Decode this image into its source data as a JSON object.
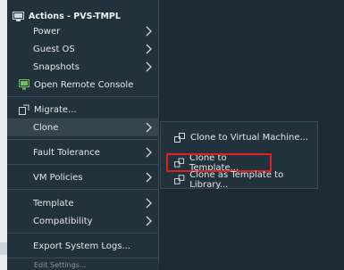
{
  "menu": {
    "title": "Actions - PVS-TMPL",
    "items": [
      {
        "label": "Power",
        "has_submenu": true
      },
      {
        "label": "Guest OS",
        "has_submenu": true
      },
      {
        "label": "Snapshots",
        "has_submenu": true
      },
      {
        "label": "Open Remote Console",
        "icon": "remote-console-icon"
      },
      {
        "label": "Migrate...",
        "icon": "migrate-icon"
      },
      {
        "label": "Clone",
        "has_submenu": true,
        "active": true
      },
      {
        "label": "Fault Tolerance",
        "has_submenu": true
      },
      {
        "label": "VM Policies",
        "has_submenu": true
      },
      {
        "label": "Template",
        "has_submenu": true
      },
      {
        "label": "Compatibility",
        "has_submenu": true
      },
      {
        "label": "Export System Logs..."
      }
    ],
    "bottom_partial": "Edit Settings..."
  },
  "clone_submenu": {
    "items": [
      {
        "label": "Clone to Virtual Machine...",
        "icon": "clone-vm-icon"
      },
      {
        "label": "Clone to Template...",
        "icon": "clone-template-icon",
        "highlighted": true
      },
      {
        "label": "Clone as Template to Library...",
        "icon": "clone-library-icon"
      }
    ]
  },
  "colors": {
    "menu_bg": "#22323d",
    "active_bg": "#344551",
    "highlight_border": "#e02020"
  }
}
